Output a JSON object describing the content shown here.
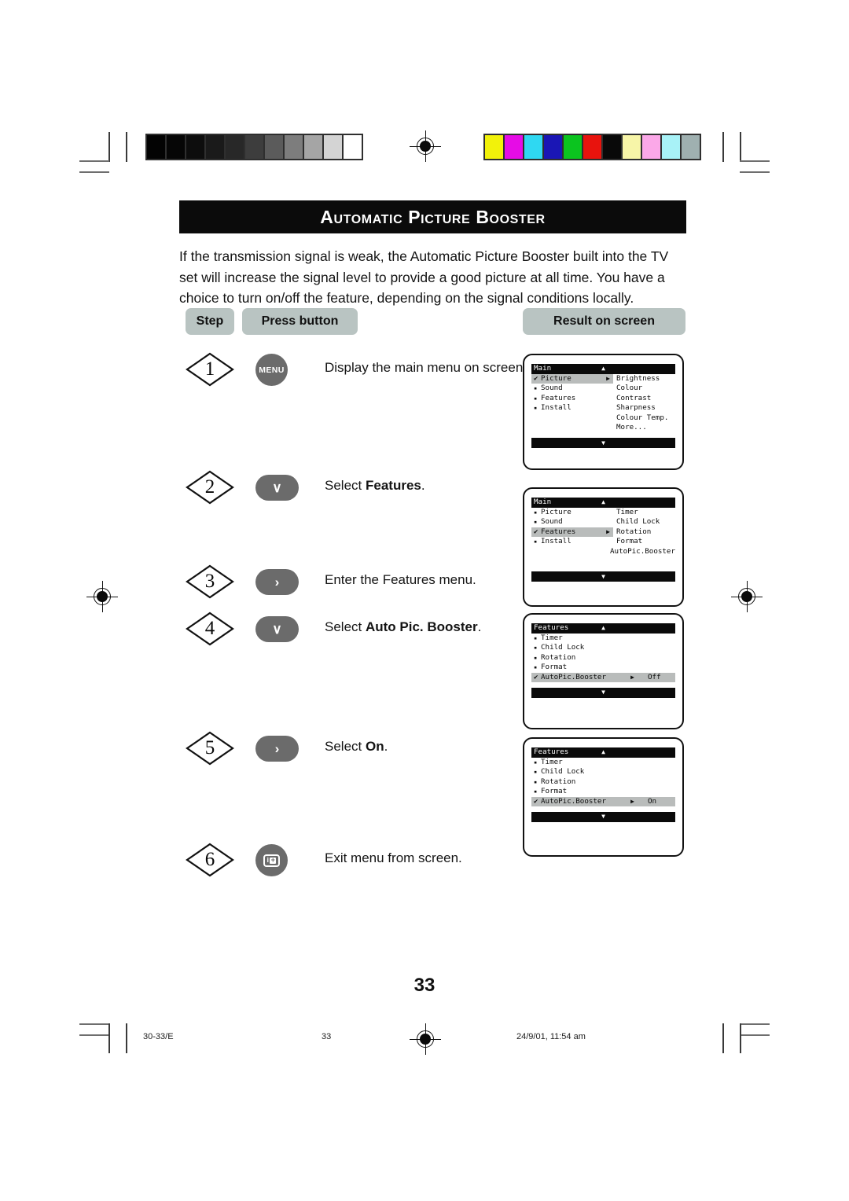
{
  "page": {
    "title": "Automatic Picture Booster",
    "intro": "If the transmission signal is weak, the Automatic Picture Booster built into the TV set will increase the signal level to provide a good picture at all time. You have a choice to turn on/off the feature, depending on the signal conditions locally.",
    "page_number": "33"
  },
  "headers": {
    "step": "Step",
    "press_button": "Press button",
    "result": "Result on screen"
  },
  "steps": [
    {
      "number": "1",
      "button_label": "MENU",
      "button_kind": "round-menu",
      "desc_prefix": "Display the main menu on screen.",
      "desc_bold": "",
      "desc_suffix": ""
    },
    {
      "number": "2",
      "button_label": "∨",
      "button_kind": "pill-chevron-down",
      "desc_prefix": "Select ",
      "desc_bold": "Features",
      "desc_suffix": "."
    },
    {
      "number": "3",
      "button_label": "›",
      "button_kind": "pill-chevron-right",
      "desc_prefix": "Enter the Features menu.",
      "desc_bold": "",
      "desc_suffix": ""
    },
    {
      "number": "4",
      "button_label": "∨",
      "button_kind": "pill-chevron-down",
      "desc_prefix": "Select ",
      "desc_bold": "Auto Pic. Booster",
      "desc_suffix": "."
    },
    {
      "number": "5",
      "button_label": "›",
      "button_kind": "pill-chevron-right",
      "desc_prefix": "Select ",
      "desc_bold": "On",
      "desc_suffix": "."
    },
    {
      "number": "6",
      "button_label": "i",
      "button_kind": "round-screen-icon",
      "desc_prefix": "Exit menu from screen.",
      "desc_bold": "",
      "desc_suffix": ""
    }
  ],
  "screens": [
    {
      "header": "Main",
      "up_arrow": "▲",
      "down_arrow": "▼",
      "left_items": [
        {
          "label": "Picture",
          "marker": "check",
          "selected": true,
          "arrow": "▶"
        },
        {
          "label": "Sound",
          "marker": "bullet",
          "selected": false,
          "arrow": ""
        },
        {
          "label": "Features",
          "marker": "bullet",
          "selected": false,
          "arrow": ""
        },
        {
          "label": "Install",
          "marker": "bullet",
          "selected": false,
          "arrow": ""
        }
      ],
      "right_items": [
        "Brightness",
        "Colour",
        "Contrast",
        "Sharpness",
        "Colour Temp.",
        "More..."
      ]
    },
    {
      "header": "Main",
      "up_arrow": "▲",
      "down_arrow": "▼",
      "left_items": [
        {
          "label": "Picture",
          "marker": "bullet",
          "selected": false,
          "arrow": ""
        },
        {
          "label": "Sound",
          "marker": "bullet",
          "selected": false,
          "arrow": ""
        },
        {
          "label": "Features",
          "marker": "check",
          "selected": true,
          "arrow": "▶"
        },
        {
          "label": "Install",
          "marker": "bullet",
          "selected": false,
          "arrow": ""
        }
      ],
      "right_items": [
        "Timer",
        "Child Lock",
        "Rotation",
        "Format",
        "AutoPic.Booster"
      ]
    },
    {
      "header": "Features",
      "up_arrow": "▲",
      "down_arrow": "▼",
      "left_items": [
        {
          "label": "Timer",
          "marker": "bullet",
          "selected": false,
          "arrow": "",
          "value": ""
        },
        {
          "label": "Child Lock",
          "marker": "bullet",
          "selected": false,
          "arrow": "",
          "value": ""
        },
        {
          "label": "Rotation",
          "marker": "bullet",
          "selected": false,
          "arrow": "",
          "value": ""
        },
        {
          "label": "Format",
          "marker": "bullet",
          "selected": false,
          "arrow": "",
          "value": ""
        },
        {
          "label": "AutoPic.Booster",
          "marker": "check",
          "selected": true,
          "arrow": "▶",
          "value": "Off"
        }
      ],
      "right_items": []
    },
    {
      "header": "Features",
      "up_arrow": "▲",
      "down_arrow": "▼",
      "left_items": [
        {
          "label": "Timer",
          "marker": "bullet",
          "selected": false,
          "arrow": "",
          "value": ""
        },
        {
          "label": "Child Lock",
          "marker": "bullet",
          "selected": false,
          "arrow": "",
          "value": ""
        },
        {
          "label": "Rotation",
          "marker": "bullet",
          "selected": false,
          "arrow": "",
          "value": ""
        },
        {
          "label": "Format",
          "marker": "bullet",
          "selected": false,
          "arrow": "",
          "value": ""
        },
        {
          "label": "AutoPic.Booster",
          "marker": "check",
          "selected": true,
          "arrow": "▶",
          "value": "On"
        }
      ],
      "right_items": []
    }
  ],
  "footer": {
    "left": "30-33/E",
    "center": "33",
    "right": "24/9/01, 11:54 am"
  },
  "color_bars": {
    "greyscale": [
      "#030303",
      "#060606",
      "#0d0d0d",
      "#1a1a1a",
      "#282828",
      "#3d3d3d",
      "#5b5b5b",
      "#7d7d7d",
      "#a5a5a5",
      "#d4d4d4",
      "#ffffff"
    ],
    "colors": [
      "#f2f20a",
      "#e60ce6",
      "#2fd8f2",
      "#1a16b5",
      "#0bc41f",
      "#e8130d",
      "#090909",
      "#f7f5a8",
      "#fba8e8",
      "#a8f2f7",
      "#9fb0b0"
    ]
  }
}
